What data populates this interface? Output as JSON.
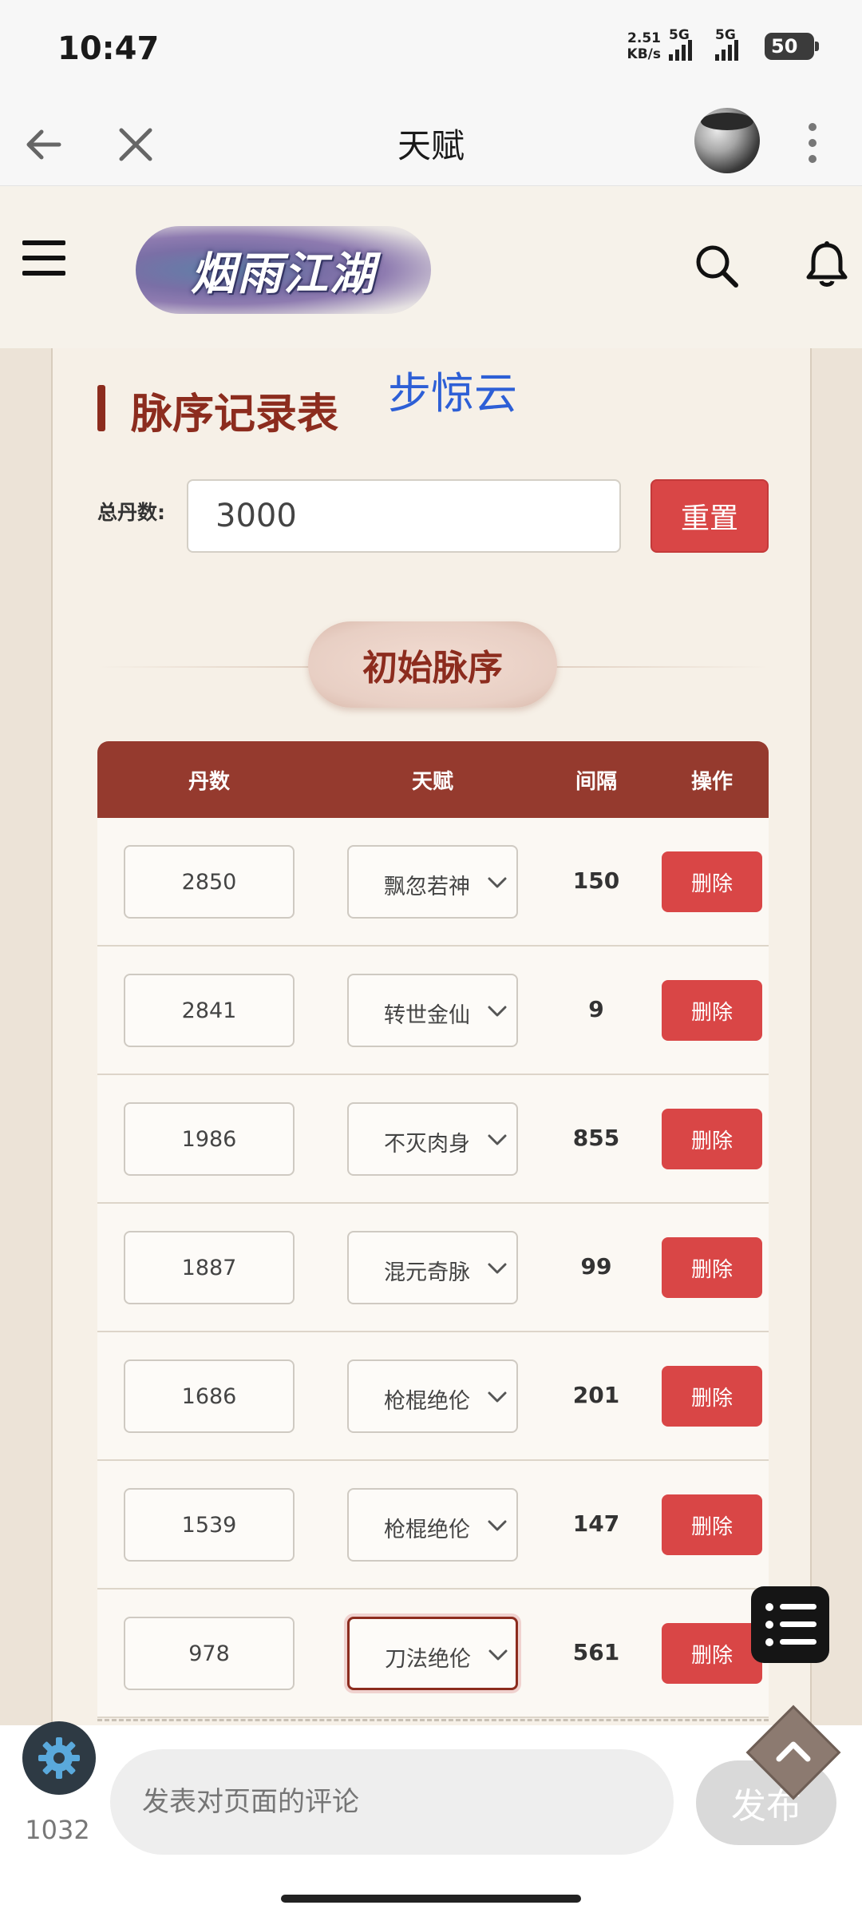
{
  "status_bar": {
    "time": "10:47",
    "net_speed_value": "2.51",
    "net_speed_unit": "KB/s",
    "signal1_label": "5G",
    "signal2_label": "5G",
    "battery": "50"
  },
  "title_bar": {
    "title": "天赋"
  },
  "site_header": {
    "logo_text": "烟雨江湖"
  },
  "main": {
    "section_title": "脉序记录表",
    "overlay_name": "步惊云",
    "total_label": "总丹数:",
    "total_value": "3000",
    "reset_label": "重置",
    "phase_label": "初始脉序",
    "table": {
      "headers": [
        "丹数",
        "天赋",
        "间隔",
        "操作"
      ],
      "rows": [
        {
          "dan": "2850",
          "talent": "飘忽若神",
          "interval": "150",
          "action": "删除"
        },
        {
          "dan": "2841",
          "talent": "转世金仙",
          "interval": "9",
          "action": "删除"
        },
        {
          "dan": "1986",
          "talent": "不灭肉身",
          "interval": "855",
          "action": "删除"
        },
        {
          "dan": "1887",
          "talent": "混元奇脉",
          "interval": "99",
          "action": "删除"
        },
        {
          "dan": "1686",
          "talent": "枪棍绝伦",
          "interval": "201",
          "action": "删除"
        },
        {
          "dan": "1539",
          "talent": "枪棍绝伦",
          "interval": "147",
          "action": "删除"
        },
        {
          "dan": "978",
          "talent": "刀法绝伦",
          "interval": "561",
          "action": "删除"
        }
      ]
    }
  },
  "comment": {
    "count": "1032",
    "placeholder": "发表对页面的评论",
    "publish_label": "发布"
  },
  "icons": {
    "back": "arrow-left-icon",
    "close": "close-icon",
    "more": "more-vertical-icon",
    "menu": "hamburger-icon",
    "search": "search-icon",
    "bell": "bell-icon",
    "list": "list-icon",
    "scroll_top": "chevron-up-icon",
    "gear": "gear-icon"
  },
  "colors": {
    "accent": "#8c2c1e",
    "table_header": "#953a2e",
    "danger": "#d94646",
    "overlay_text": "#2d5fd6"
  }
}
